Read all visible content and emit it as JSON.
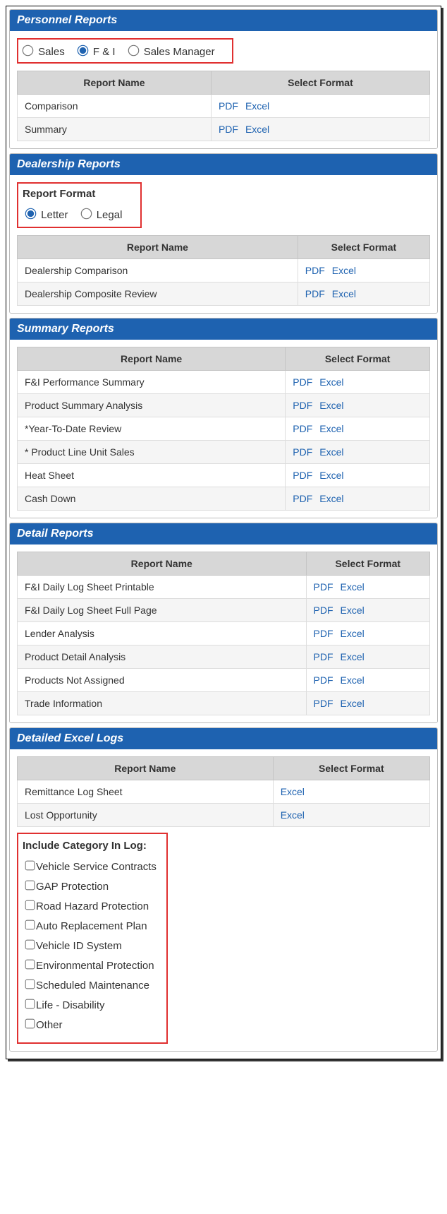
{
  "labels": {
    "col_report_name": "Report Name",
    "col_select_format": "Select Format",
    "pdf": "PDF",
    "excel": "Excel"
  },
  "personnel": {
    "title": "Personnel Reports",
    "radios": [
      "Sales",
      "F & I",
      "Sales Manager"
    ],
    "selected": 1,
    "rows": [
      "Comparison",
      "Summary"
    ]
  },
  "dealership": {
    "title": "Dealership Reports",
    "format_title": "Report Format",
    "radios": [
      "Letter",
      "Legal"
    ],
    "selected": 0,
    "rows": [
      "Dealership Comparison",
      "Dealership Composite Review"
    ]
  },
  "summary": {
    "title": "Summary Reports",
    "rows": [
      "F&I Performance Summary",
      "Product Summary Analysis",
      "*Year-To-Date Review",
      "* Product Line Unit Sales",
      "Heat Sheet",
      "Cash Down"
    ]
  },
  "detail": {
    "title": "Detail Reports",
    "rows": [
      "F&I Daily Log Sheet Printable",
      "F&I Daily Log Sheet Full Page",
      "Lender Analysis",
      "Product Detail Analysis",
      "Products Not Assigned",
      "Trade Information"
    ]
  },
  "excel_logs": {
    "title": "Detailed Excel Logs",
    "rows": [
      "Remittance Log Sheet",
      "Lost Opportunity"
    ]
  },
  "categories": {
    "title": "Include Category In Log:",
    "items": [
      "Vehicle Service Contracts",
      "GAP Protection",
      "Road Hazard Protection",
      "Auto Replacement Plan",
      "Vehicle ID System",
      "Environmental Protection",
      "Scheduled Maintenance",
      "Life - Disability",
      "Other"
    ]
  }
}
